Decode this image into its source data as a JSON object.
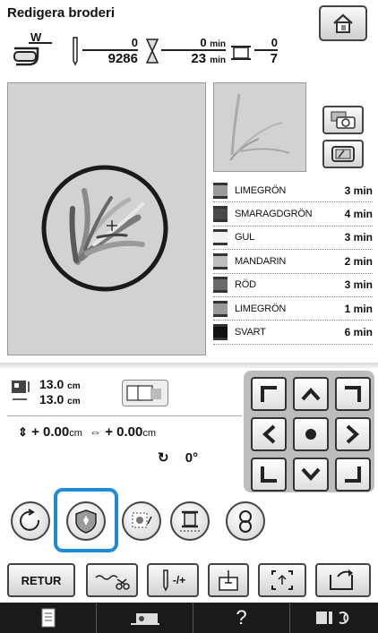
{
  "title": "Redigera broderi",
  "counters": {
    "stitch_current": "0",
    "stitch_total": "9286",
    "time_current": "0",
    "time_total": "23",
    "time_unit": "min",
    "color_current": "0",
    "color_total": "7",
    "thread_label": "W"
  },
  "colors": [
    {
      "name": "LIMEGRÖN",
      "time": "3 min",
      "swatch": "#9a9a9a"
    },
    {
      "name": "SMARAGDGRÖN",
      "time": "4 min",
      "swatch": "#4a4a4a"
    },
    {
      "name": "GUL",
      "time": "3 min",
      "swatch": "#f2f2f2"
    },
    {
      "name": "MANDARIN",
      "time": "2 min",
      "swatch": "#bdbdbd"
    },
    {
      "name": "RÖD",
      "time": "3 min",
      "swatch": "#6a6a6a"
    },
    {
      "name": "LIMEGRÖN",
      "time": "1 min",
      "swatch": "#9a9a9a"
    },
    {
      "name": "SVART",
      "time": "6 min",
      "swatch": "#111111"
    }
  ],
  "size": {
    "height": "13.0",
    "width": "13.0",
    "unit": "cm"
  },
  "offset": {
    "v_value": "+ 0.00",
    "h_value": "+ 0.00",
    "unit": "cm",
    "rotation": "0°"
  },
  "buttons": {
    "retur": "RETUR",
    "density_label": "-/+"
  },
  "accent": "#1e8bd6",
  "icons": [
    "home-icon",
    "camera-icon",
    "frame-view-icon",
    "rotate-icon",
    "border-icon",
    "density-icon",
    "thread-color-icon",
    "sequence-icon",
    "thread-trim-icon",
    "fit-icon",
    "page-icon",
    "camera-footer-icon",
    "help-icon",
    "settings-icon"
  ]
}
